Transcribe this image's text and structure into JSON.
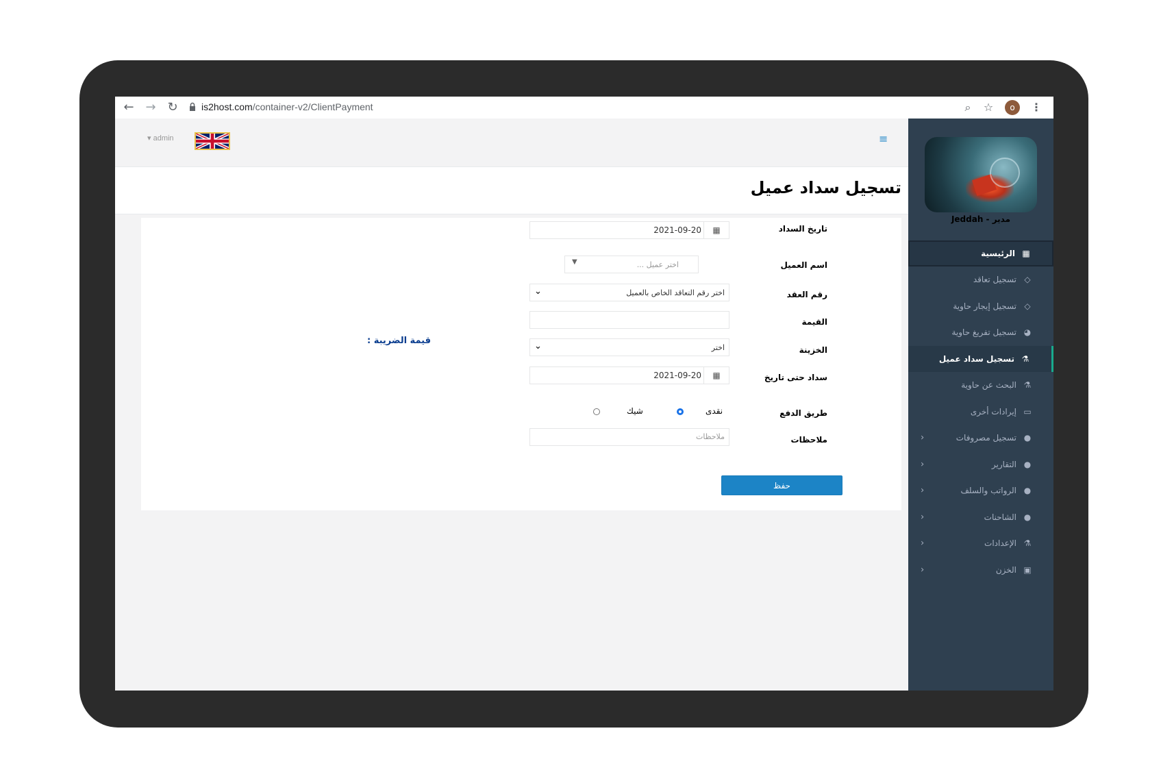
{
  "browser": {
    "url_host": "is2host.com",
    "url_path": "/container-v2/ClientPayment",
    "profile_initial": "o"
  },
  "header": {
    "user": "admin"
  },
  "sidebar": {
    "profile_name": "Jeddah - مدير",
    "items": [
      {
        "label": "الرئيسية",
        "icon": "grid-icon"
      },
      {
        "label": "تسجيل تعاقد",
        "icon": "diamond-icon"
      },
      {
        "label": "تسجيل إيجار حاوية",
        "icon": "diamond-icon"
      },
      {
        "label": "تسجيل تفريغ حاوية",
        "icon": "pie-chart-icon"
      },
      {
        "label": "تسجيل سداد عميل",
        "icon": "flask-icon"
      },
      {
        "label": "البحث عن حاوية",
        "icon": "flask-icon"
      },
      {
        "label": "إيرادات أخرى",
        "icon": "desktop-icon"
      },
      {
        "label": "تسجيل مصروفات",
        "icon": "globe-icon"
      },
      {
        "label": "التقارير",
        "icon": "globe-icon"
      },
      {
        "label": "الرواتب والسلف",
        "icon": "globe-icon"
      },
      {
        "label": "الشاحنات",
        "icon": "globe-icon"
      },
      {
        "label": "الإعدادات",
        "icon": "flask-icon"
      },
      {
        "label": "الخزن",
        "icon": "money-icon"
      }
    ]
  },
  "page": {
    "title": "تسجيل سداد عميل"
  },
  "form": {
    "payment_date_label": "تاريخ السداد",
    "payment_date_value": "2021-09-20",
    "client_name_label": "اسم العميل",
    "client_name_placeholder": "اختر عميل ...",
    "contract_no_label": "رقم العقد",
    "contract_no_value": "اختر رقم التعاقد الخاص بالعميل",
    "amount_label": "القيمة",
    "amount_value": "",
    "treasury_label": "الخزينة",
    "treasury_value": "اختر",
    "paid_until_label": "سداد حتى تاريخ",
    "paid_until_value": "2021-09-20",
    "payment_method_label": "طريق الدفع",
    "payment_method_cash": "نقدى",
    "payment_method_cheque": "شيك",
    "payment_method_selected": "cash",
    "notes_label": "ملاحظات",
    "notes_placeholder": "ملاحظات",
    "save_label": "حفظ",
    "tax_label": "قيمة الضريبة :"
  }
}
